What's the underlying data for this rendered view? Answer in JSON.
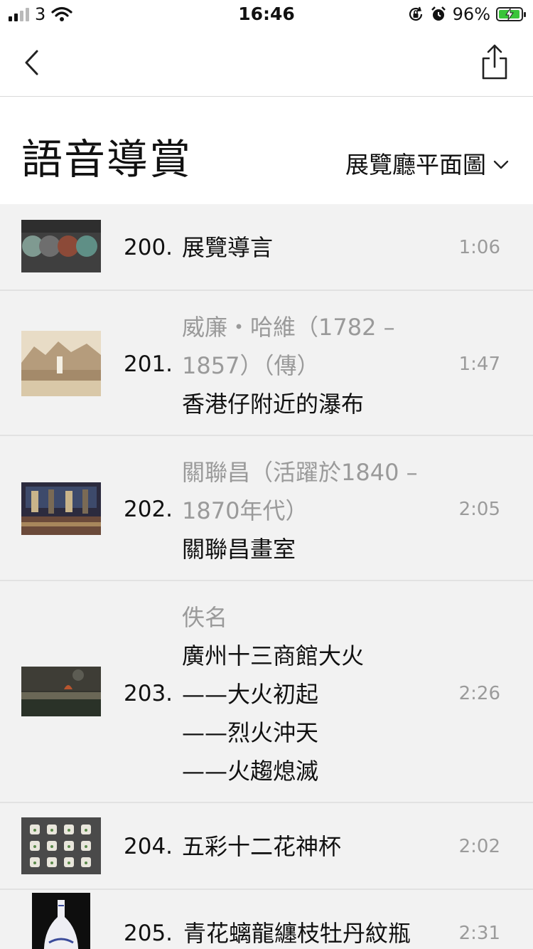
{
  "status_bar": {
    "carrier": "3",
    "time": "16:46",
    "battery_percent": "96%",
    "icons": [
      "signal-icon",
      "wifi-icon",
      "orientation-lock-icon",
      "alarm-icon",
      "battery-charging-icon"
    ]
  },
  "nav": {
    "back_icon": "chevron-left-icon",
    "share_icon": "share-icon"
  },
  "header": {
    "title": "語音導賞",
    "floor_plan_label": "展覽廳平面圖"
  },
  "colors": {
    "list_bg": "#f2f2f2",
    "secondary_text": "#9a9a9a",
    "battery_green": "#3ac43a"
  },
  "items": [
    {
      "number": "200.",
      "lines": [
        {
          "text": "展覽導言",
          "style": "title"
        }
      ],
      "duration": "1:06"
    },
    {
      "number": "201.",
      "lines": [
        {
          "text": "威廉・哈維（1782 –",
          "style": "artist"
        },
        {
          "text": "1857）（傳）",
          "style": "artist"
        },
        {
          "text": "香港仔附近的瀑布",
          "style": "title"
        }
      ],
      "duration": "1:47"
    },
    {
      "number": "202.",
      "lines": [
        {
          "text": "關聯昌（活躍於1840 –",
          "style": "artist"
        },
        {
          "text": "1870年代）",
          "style": "artist"
        },
        {
          "text": "關聯昌畫室",
          "style": "title"
        }
      ],
      "duration": "2:05"
    },
    {
      "number": "203.",
      "lines": [
        {
          "text": "佚名",
          "style": "artist"
        },
        {
          "text": "廣州十三商館大火",
          "style": "title"
        },
        {
          "text": "——大火初起",
          "style": "title"
        },
        {
          "text": "——烈火沖天",
          "style": "title"
        },
        {
          "text": "——火趨熄滅",
          "style": "title"
        }
      ],
      "duration": "2:26"
    },
    {
      "number": "204.",
      "lines": [
        {
          "text": "五彩十二花神杯",
          "style": "title"
        }
      ],
      "duration": "2:02"
    },
    {
      "number": "205.",
      "lines": [
        {
          "text": "青花螭龍纏枝牡丹紋瓶",
          "style": "title"
        }
      ],
      "duration": "2:31"
    }
  ]
}
